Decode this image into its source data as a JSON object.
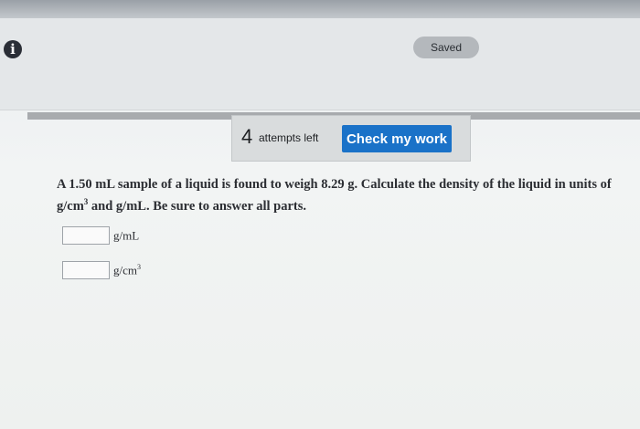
{
  "header": {
    "saved_label": "Saved",
    "info_icon": "info-icon",
    "info_glyph": "i"
  },
  "attempts": {
    "count": "4",
    "label": "attempts left",
    "check_button_label": "Check my work"
  },
  "question": {
    "text_before_sup": "A 1.50 mL sample of a liquid is found to weigh 8.29 g. Calculate the density of the liquid in units of g/cm",
    "sup": "3",
    "text_after_sup": " and g/mL. Be sure to answer all parts."
  },
  "answers": [
    {
      "value": "",
      "unit": "g/mL",
      "unit_sup": ""
    },
    {
      "value": "",
      "unit": "g/cm",
      "unit_sup": "3"
    }
  ],
  "colors": {
    "accent": "#1a72c8",
    "saved_pill": "#b4b8bc",
    "divider": "#a8abae"
  }
}
